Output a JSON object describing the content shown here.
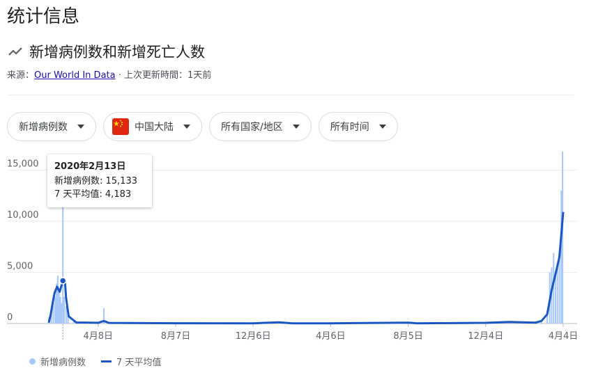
{
  "page": {
    "title": "统计信息"
  },
  "chart_header": {
    "title": "新增病例数和新增死亡人数",
    "icon": "trending-icon",
    "source_prefix": "来源：",
    "source_link": "Our World In Data",
    "separator": " · ",
    "updated": "上次更新時間：1天前"
  },
  "filters": [
    {
      "label": "新增病例数"
    },
    {
      "label": "中国大陆",
      "icon": "china-flag-icon"
    },
    {
      "label": "所有国家/地区"
    },
    {
      "label": "所有时间"
    }
  ],
  "tooltip": {
    "date": "2020年2月13日",
    "cases_line": "新增病例数: 15,133",
    "avg_line": "7 天平均值: 4,183"
  },
  "legend": {
    "cases": "新增病例数",
    "average": "7 天平均值"
  },
  "colors": {
    "bars": "#a8c7fa",
    "line": "#1a56c4",
    "link": "#1a0dab"
  },
  "chart_data": {
    "type": "bar",
    "y_ticks": [
      "0",
      "5,000",
      "10,000",
      "15,000"
    ],
    "y_tick_values": [
      0,
      5000,
      10000,
      15000
    ],
    "ylim": [
      0,
      17000
    ],
    "x_tick_labels": [
      "4月8日",
      "8月7日",
      "12月6日",
      "4月6日",
      "8月5日",
      "12月4日",
      "4月4日"
    ],
    "x_range": [
      "2020-01-22",
      "2022-04-04"
    ],
    "x_ticks_dates": [
      "2020-04-08",
      "2020-08-07",
      "2020-12-06",
      "2021-04-06",
      "2021-08-05",
      "2021-12-04",
      "2022-04-04"
    ],
    "highlight_date": "2020-02-13",
    "series": [
      {
        "name": "新增病例数",
        "type": "bar",
        "points": [
          [
            "2020-01-22",
            500
          ],
          [
            "2020-01-26",
            1300
          ],
          [
            "2020-01-29",
            2500
          ],
          [
            "2020-02-01",
            2600
          ],
          [
            "2020-02-03",
            3900
          ],
          [
            "2020-02-05",
            4700
          ],
          [
            "2020-02-07",
            3300
          ],
          [
            "2020-02-09",
            2600
          ],
          [
            "2020-02-11",
            2000
          ],
          [
            "2020-02-13",
            15133
          ],
          [
            "2020-02-15",
            2600
          ],
          [
            "2020-02-18",
            1700
          ],
          [
            "2020-02-21",
            800
          ],
          [
            "2020-03-01",
            200
          ],
          [
            "2020-04-17",
            1500
          ],
          [
            "2020-05-01",
            50
          ],
          [
            "2020-08-01",
            80
          ],
          [
            "2021-01-15",
            150
          ],
          [
            "2021-08-05",
            120
          ],
          [
            "2021-12-30",
            200
          ],
          [
            "2022-03-01",
            300
          ],
          [
            "2022-03-10",
            1200
          ],
          [
            "2022-03-14",
            5000
          ],
          [
            "2022-03-17",
            5500
          ],
          [
            "2022-03-20",
            6900
          ],
          [
            "2022-03-23",
            4800
          ],
          [
            "2022-03-26",
            5600
          ],
          [
            "2022-03-29",
            7000
          ],
          [
            "2022-04-01",
            13000
          ],
          [
            "2022-04-03",
            16800
          ]
        ]
      },
      {
        "name": "7 天平均值",
        "type": "line",
        "points": [
          [
            "2020-01-22",
            80
          ],
          [
            "2020-01-25",
            900
          ],
          [
            "2020-01-28",
            2000
          ],
          [
            "2020-01-31",
            3000
          ],
          [
            "2020-02-04",
            3600
          ],
          [
            "2020-02-08",
            3100
          ],
          [
            "2020-02-13",
            4183
          ],
          [
            "2020-02-16",
            4300
          ],
          [
            "2020-02-18",
            2500
          ],
          [
            "2020-02-22",
            700
          ],
          [
            "2020-03-05",
            100
          ],
          [
            "2020-04-08",
            70
          ],
          [
            "2020-04-17",
            250
          ],
          [
            "2020-04-25",
            60
          ],
          [
            "2020-08-07",
            30
          ],
          [
            "2020-12-06",
            20
          ],
          [
            "2021-01-15",
            120
          ],
          [
            "2021-02-05",
            20
          ],
          [
            "2021-04-06",
            20
          ],
          [
            "2021-08-05",
            90
          ],
          [
            "2021-08-20",
            20
          ],
          [
            "2021-12-04",
            70
          ],
          [
            "2022-01-10",
            150
          ],
          [
            "2022-02-20",
            90
          ],
          [
            "2022-03-01",
            250
          ],
          [
            "2022-03-10",
            900
          ],
          [
            "2022-03-17",
            3300
          ],
          [
            "2022-03-24",
            5100
          ],
          [
            "2022-03-29",
            6500
          ],
          [
            "2022-04-04",
            10900
          ]
        ]
      }
    ]
  }
}
